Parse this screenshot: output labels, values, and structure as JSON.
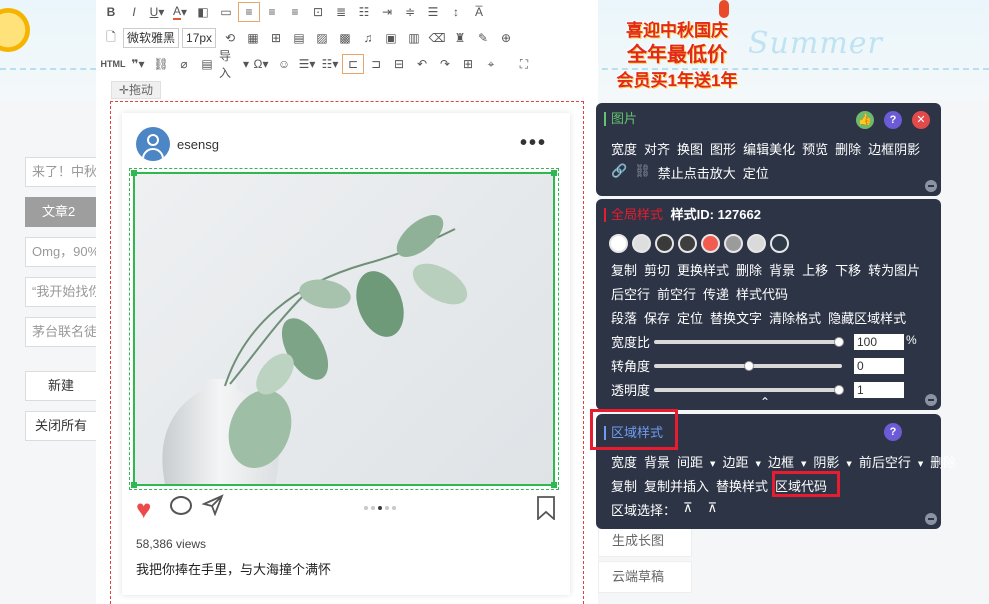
{
  "toolbar": {
    "font_family": "微软雅黑",
    "font_size": "17px",
    "html_label": "HTML",
    "import_label": "导入",
    "drag_label": "拖动"
  },
  "promo": {
    "line1": "喜迎中秋国庆",
    "line2": "全年最低价",
    "line3": "会员买1年送1年"
  },
  "banner_text": "Summer",
  "left_sidebar": {
    "items": [
      "来了！中秋",
      "文章2",
      "Omg，90%",
      "“我开始找你",
      "茅台联名徒"
    ],
    "new_button": "新建",
    "close_all_button": "关闭所有"
  },
  "post": {
    "username": "esensg",
    "views": "58,386 views",
    "caption": "我把你捧在手里，与大海撞个满怀"
  },
  "right_tabs": [
    "生成长图",
    "云端草稿"
  ],
  "image_panel": {
    "title": "图片",
    "row1": [
      "宽度",
      "对齐",
      "换图",
      "图形",
      "编辑美化",
      "预览",
      "删除",
      "边框阴影"
    ],
    "row2": [
      "禁止点击放大",
      "定位"
    ]
  },
  "global_panel": {
    "title": "全局样式",
    "style_id": "样式ID: 127662",
    "swatches": [
      "#ffffff",
      "#dedede",
      "#3a3a3a",
      "#3e3e3e",
      "#f15b50",
      "#9b9b9b",
      "#dadada",
      "#2f3a48"
    ],
    "row1": [
      "复制",
      "剪切",
      "更换样式",
      "删除",
      "背景",
      "上移",
      "下移",
      "转为图片"
    ],
    "row2": [
      "后空行",
      "前空行",
      "传递",
      "样式代码"
    ],
    "row3": [
      "段落",
      "保存",
      "定位",
      "替换文字",
      "清除格式",
      "隐藏区域样式"
    ],
    "sliders": [
      {
        "label": "宽度比",
        "value": "100",
        "unit": "%",
        "pos": 1.0
      },
      {
        "label": "转角度",
        "value": "0",
        "unit": "",
        "pos": 0.5
      },
      {
        "label": "透明度",
        "value": "1",
        "unit": "",
        "pos": 1.0
      }
    ]
  },
  "area_panel": {
    "title": "区域样式",
    "row1": [
      "宽度",
      "背景",
      "间距",
      "边距",
      "边框",
      "阴影",
      "前后空行",
      "删除"
    ],
    "row2": [
      "复制",
      "复制并插入",
      "替换样式",
      "区域代码"
    ],
    "row3_label": "区域选择："
  },
  "colors": {
    "panel_bg": "#2c3446",
    "accent_red": "#e81c2e",
    "selection_green": "#2eb84f",
    "help_purple": "#6b5bd6",
    "title_green": "#63c36f"
  }
}
